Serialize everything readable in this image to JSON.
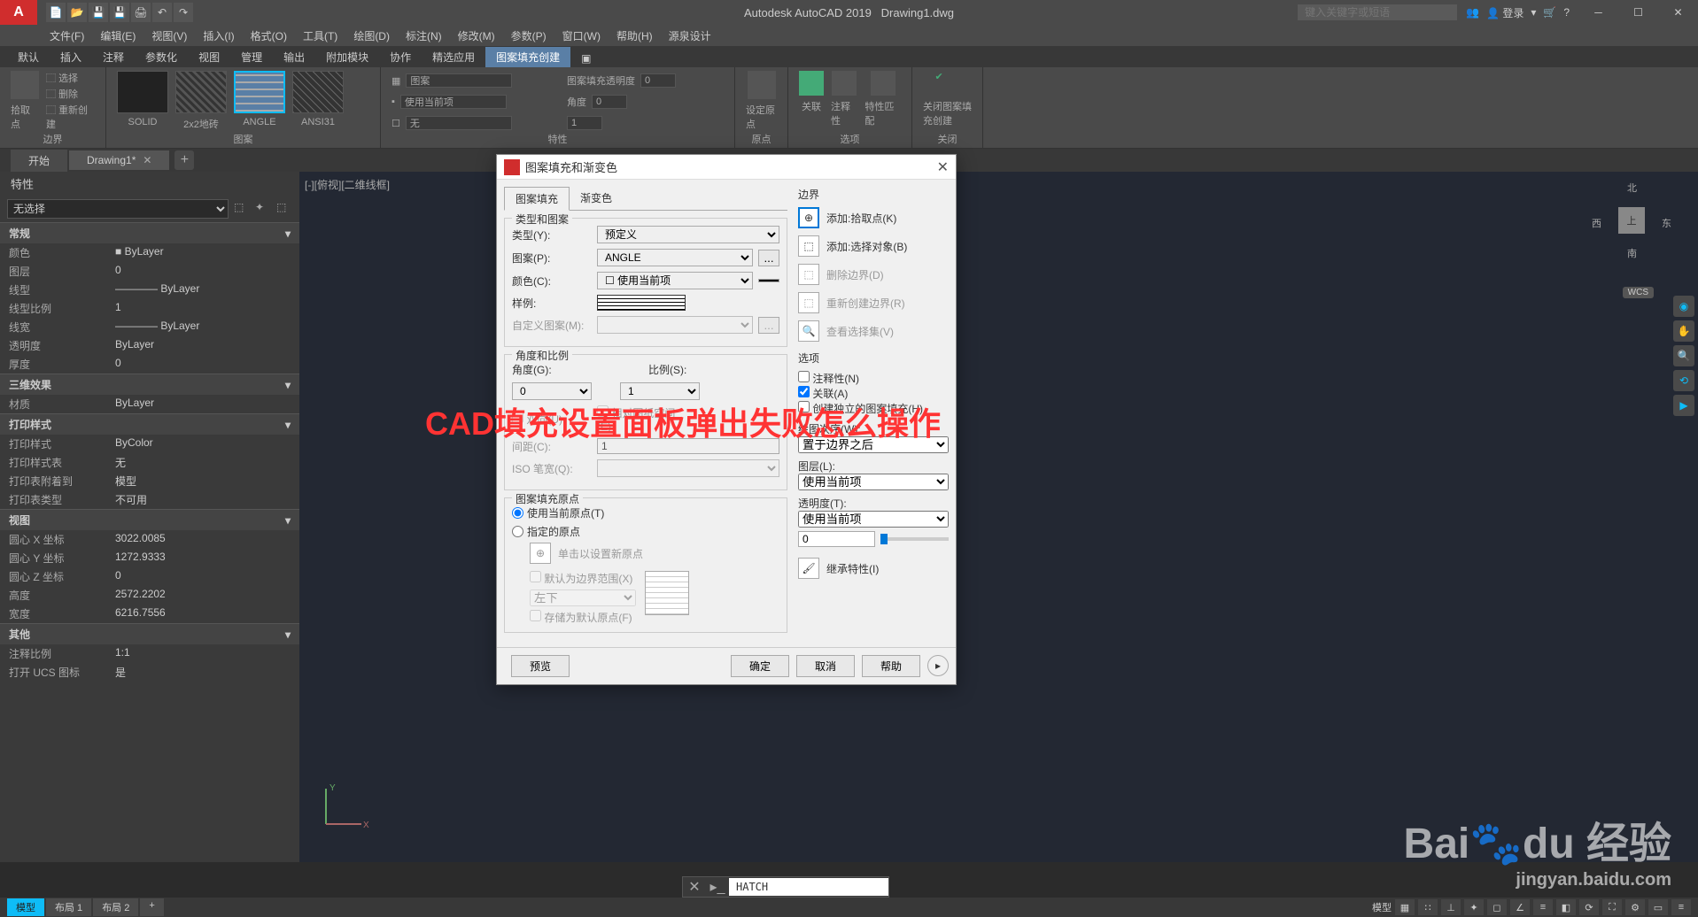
{
  "app": {
    "title": "Autodesk AutoCAD 2019",
    "document": "Drawing1.dwg",
    "search_placeholder": "键入关键字或短语",
    "login": "登录"
  },
  "menus": [
    "文件(F)",
    "编辑(E)",
    "视图(V)",
    "插入(I)",
    "格式(O)",
    "工具(T)",
    "绘图(D)",
    "标注(N)",
    "修改(M)",
    "参数(P)",
    "窗口(W)",
    "帮助(H)",
    "源泉设计"
  ],
  "ribbon_tabs": [
    "默认",
    "插入",
    "注释",
    "参数化",
    "视图",
    "管理",
    "输出",
    "附加模块",
    "协作",
    "精选应用",
    "图案填充创建"
  ],
  "ribbon_active_tab": "图案填充创建",
  "ribbon": {
    "panel1": {
      "label": "边界",
      "items": [
        "选择",
        "删除",
        "重新创建"
      ],
      "main": "拾取点"
    },
    "panel2": {
      "label": "图案",
      "patterns": [
        "SOLID",
        "2x2地砖",
        "ANGLE",
        "ANSI31"
      ]
    },
    "panel3": {
      "label": "特性",
      "row1_label": "图案",
      "row2_label": "使用当前项",
      "row3_label": "无",
      "trans_label": "图案填充透明度",
      "trans_val": "0",
      "angle_label": "角度",
      "angle_val": "0",
      "scale_val": "1"
    },
    "panel4": {
      "label": "原点",
      "btn": "设定原点"
    },
    "panel5": {
      "label": "选项",
      "btns": [
        "关联",
        "注释性",
        "特性匹配"
      ]
    },
    "panel6": {
      "label": "关闭",
      "btn": "关闭图案填充创建"
    }
  },
  "doc_tabs": {
    "start": "开始",
    "active": "Drawing1*"
  },
  "properties": {
    "title": "特性",
    "selector": "无选择",
    "sections": {
      "general": {
        "title": "常规",
        "rows": [
          {
            "l": "颜色",
            "v": "■ ByLayer"
          },
          {
            "l": "图层",
            "v": "0"
          },
          {
            "l": "线型",
            "v": "———— ByLayer"
          },
          {
            "l": "线型比例",
            "v": "1"
          },
          {
            "l": "线宽",
            "v": "———— ByLayer"
          },
          {
            "l": "透明度",
            "v": "ByLayer"
          },
          {
            "l": "厚度",
            "v": "0"
          }
        ]
      },
      "threed": {
        "title": "三维效果",
        "rows": [
          {
            "l": "材质",
            "v": "ByLayer"
          }
        ]
      },
      "print": {
        "title": "打印样式",
        "rows": [
          {
            "l": "打印样式",
            "v": "ByColor"
          },
          {
            "l": "打印样式表",
            "v": "无"
          },
          {
            "l": "打印表附着到",
            "v": "模型"
          },
          {
            "l": "打印表类型",
            "v": "不可用"
          }
        ]
      },
      "view": {
        "title": "视图",
        "rows": [
          {
            "l": "圆心 X 坐标",
            "v": "3022.0085"
          },
          {
            "l": "圆心 Y 坐标",
            "v": "1272.9333"
          },
          {
            "l": "圆心 Z 坐标",
            "v": "0"
          },
          {
            "l": "高度",
            "v": "2572.2202"
          },
          {
            "l": "宽度",
            "v": "6216.7556"
          }
        ]
      },
      "other": {
        "title": "其他",
        "rows": [
          {
            "l": "注释比例",
            "v": "1:1"
          },
          {
            "l": "打开 UCS 图标",
            "v": "是"
          }
        ]
      }
    }
  },
  "viewport": {
    "label": "[-][俯视][二维线框]",
    "cube": {
      "top": "上",
      "n": "北",
      "s": "南",
      "e": "东",
      "w": "西"
    },
    "wcs": "WCS"
  },
  "dialog": {
    "title": "图案填充和渐变色",
    "tab1": "图案填充",
    "tab2": "渐变色",
    "group_type": {
      "title": "类型和图案",
      "type_l": "类型(Y):",
      "type_v": "预定义",
      "pattern_l": "图案(P):",
      "pattern_v": "ANGLE",
      "color_l": "颜色(C):",
      "color_v": "使用当前项",
      "sample_l": "样例:",
      "custom_l": "自定义图案(M):"
    },
    "group_angle": {
      "title": "角度和比例",
      "angle_l": "角度(G):",
      "angle_v": "0",
      "scale_l": "比例(S):",
      "scale_v": "1",
      "double_l": "双向(U)",
      "rel_l": "相对图纸空间(E)",
      "spacing_l": "间距(C):",
      "spacing_v": "1",
      "iso_l": "ISO 笔宽(Q):"
    },
    "group_origin": {
      "title": "图案填充原点",
      "r1": "使用当前原点(T)",
      "r2": "指定的原点",
      "click": "单击以设置新原点",
      "default_bound": "默认为边界范围(X)",
      "pos": "左下",
      "store": "存储为默认原点(F)"
    },
    "boundary": {
      "title": "边界",
      "add_pick": "添加:拾取点(K)",
      "add_sel": "添加:选择对象(B)",
      "remove": "删除边界(D)",
      "recreate": "重新创建边界(R)",
      "viewsel": "查看选择集(V)"
    },
    "options": {
      "title": "选项",
      "annot": "注释性(N)",
      "assoc": "关联(A)",
      "indep": "创建独立的图案填充(H)",
      "draworder_l": "绘图次序(W):",
      "draworder_v": "置于边界之后",
      "layer_l": "图层(L):",
      "layer_v": "使用当前项",
      "trans_l": "透明度(T):",
      "trans_v": "使用当前项",
      "trans_num": "0",
      "inherit": "继承特性(I)"
    },
    "footer": {
      "preview": "预览",
      "ok": "确定",
      "cancel": "取消",
      "help": "帮助"
    }
  },
  "cmdline": {
    "text": "HATCH"
  },
  "statusbar": {
    "layouts": [
      "模型",
      "布局 1",
      "布局 2"
    ],
    "model_label": "模型"
  },
  "watermark": "CAD填充设置面板弹出失败怎么操作",
  "baidu": {
    "main": "Bai",
    "du": "du",
    "jy": "经验",
    "url": "jingyan.baidu.com"
  }
}
